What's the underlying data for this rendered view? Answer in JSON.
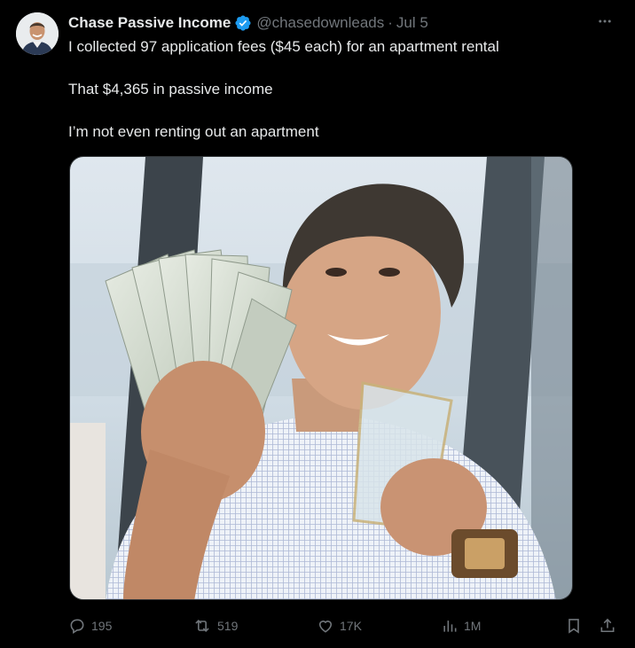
{
  "author": {
    "display_name": "Chase Passive Income",
    "handle": "@chasedownleads",
    "separator": "·",
    "date": "Jul 5",
    "verified": true
  },
  "tweet": {
    "lines": [
      "I collected 97 application fees ($45 each) for an apartment rental",
      "That $4,365 in passive income",
      "I’m not even renting out an apartment"
    ]
  },
  "media": {
    "alt_description": "Man in checked shirt holding a fan of $100 bills and a crystal glass"
  },
  "actions": {
    "replies": "195",
    "reposts": "519",
    "likes": "17K",
    "views": "1M"
  },
  "colors": {
    "background": "#000000",
    "text": "#e7e9ea",
    "muted": "#71767b",
    "verified_blue": "#1d9bf0"
  },
  "icons": [
    "more-icon",
    "verified-badge-icon",
    "reply-icon",
    "repost-icon",
    "like-icon",
    "views-icon",
    "bookmark-icon",
    "share-icon"
  ]
}
